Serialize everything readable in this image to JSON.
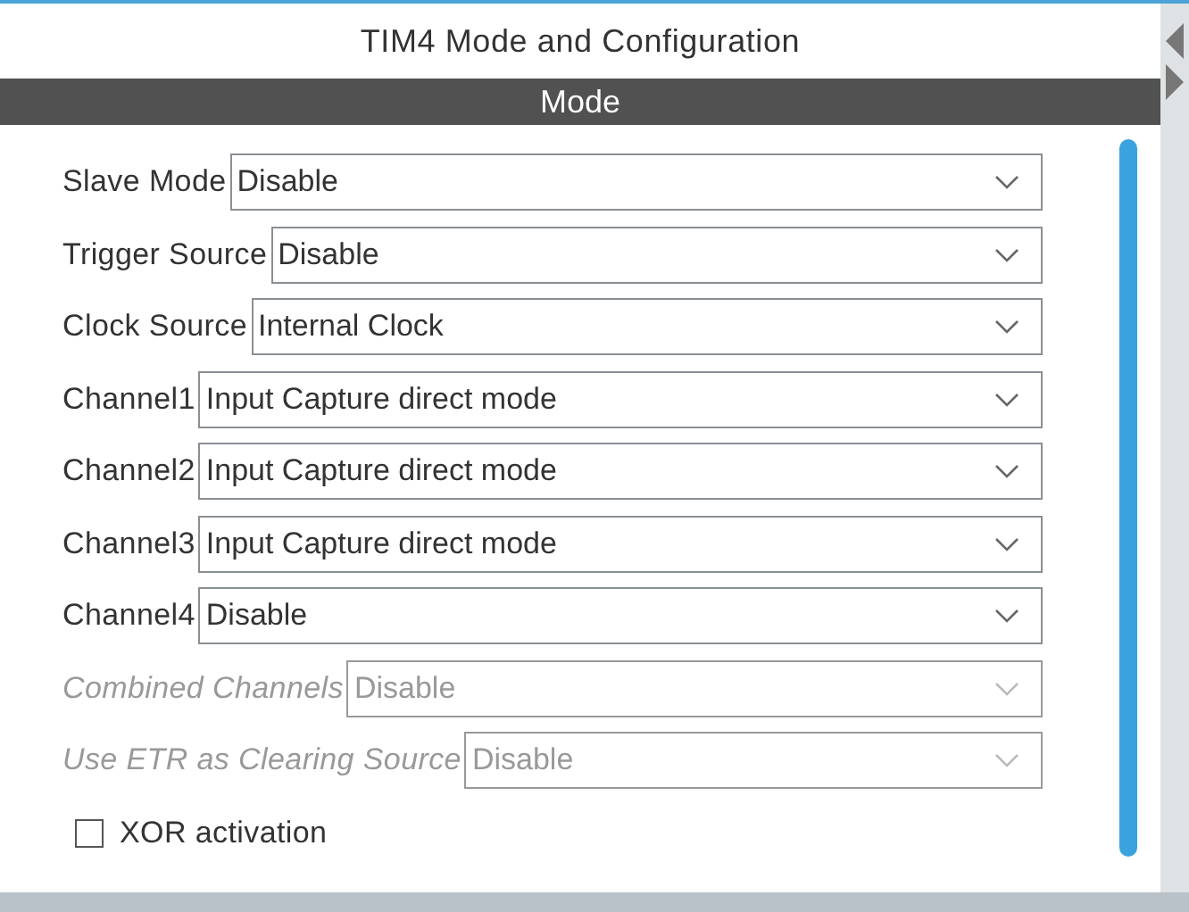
{
  "title": "TIM4 Mode and Configuration",
  "section": "Mode",
  "rows": [
    {
      "kind": "select",
      "label": "Slave Mode",
      "value": "Disable",
      "disabled": false
    },
    {
      "kind": "select",
      "label": "Trigger Source",
      "value": "Disable",
      "disabled": false
    },
    {
      "kind": "select",
      "label": "Clock Source",
      "value": "Internal Clock",
      "disabled": false
    },
    {
      "kind": "select",
      "label": "Channel1",
      "value": "Input Capture direct mode",
      "disabled": false
    },
    {
      "kind": "select",
      "label": "Channel2",
      "value": "Input Capture direct mode",
      "disabled": false
    },
    {
      "kind": "select",
      "label": "Channel3",
      "value": "Input Capture direct mode",
      "disabled": false
    },
    {
      "kind": "select",
      "label": "Channel4",
      "value": "Disable",
      "disabled": false
    },
    {
      "kind": "select",
      "label": "Combined Channels",
      "value": "Disable",
      "disabled": true
    },
    {
      "kind": "select",
      "label": "Use ETR as Clearing Source",
      "value": "Disable",
      "disabled": true
    },
    {
      "kind": "checkbox",
      "label": "XOR activation",
      "checked": false
    }
  ]
}
